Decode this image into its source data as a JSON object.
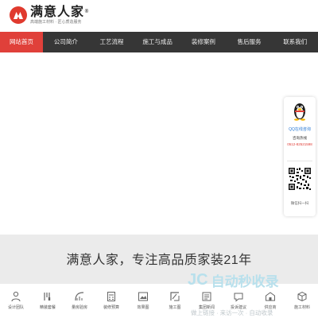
{
  "brand": {
    "name": "满意人家",
    "trademark": "®",
    "slogan": "高端施工材料 · 匠心质造服务",
    "accent": "#e0403a"
  },
  "nav": {
    "items": [
      {
        "label": "网站首页",
        "active": true
      },
      {
        "label": "公司简介",
        "active": false
      },
      {
        "label": "工艺流程",
        "active": false
      },
      {
        "label": "施工与成品",
        "active": false
      },
      {
        "label": "装修案例",
        "active": false
      },
      {
        "label": "售后服务",
        "active": false
      },
      {
        "label": "联系我们",
        "active": false
      }
    ]
  },
  "float_panel": {
    "qq_label": "QQ在线咨询",
    "hotline_label": "咨询热线",
    "hotline_number": "0512-82521598",
    "qr_label": "微信扫一扫"
  },
  "banner": {
    "title": "满意人家，专注高品质家装21年"
  },
  "watermark": {
    "logo": "JC",
    "text": "自动秒收录",
    "sub": "做上链接 · 来访一次 · 自动收录"
  },
  "bottom_bar": {
    "items": [
      {
        "label": "设计团队",
        "icon": "user-team-icon"
      },
      {
        "label": "精装套餐",
        "icon": "tools-icon"
      },
      {
        "label": "量房验房",
        "icon": "ruler-icon"
      },
      {
        "label": "装修预算",
        "icon": "calculator-icon"
      },
      {
        "label": "效果图",
        "icon": "picture-icon"
      },
      {
        "label": "施工图",
        "icon": "blueprint-icon"
      },
      {
        "label": "集团新闻",
        "icon": "news-icon"
      },
      {
        "label": "投诉建议",
        "icon": "complaint-icon"
      },
      {
        "label": "供应商",
        "icon": "supplier-icon"
      },
      {
        "label": "施工材料",
        "icon": "material-icon"
      }
    ]
  }
}
